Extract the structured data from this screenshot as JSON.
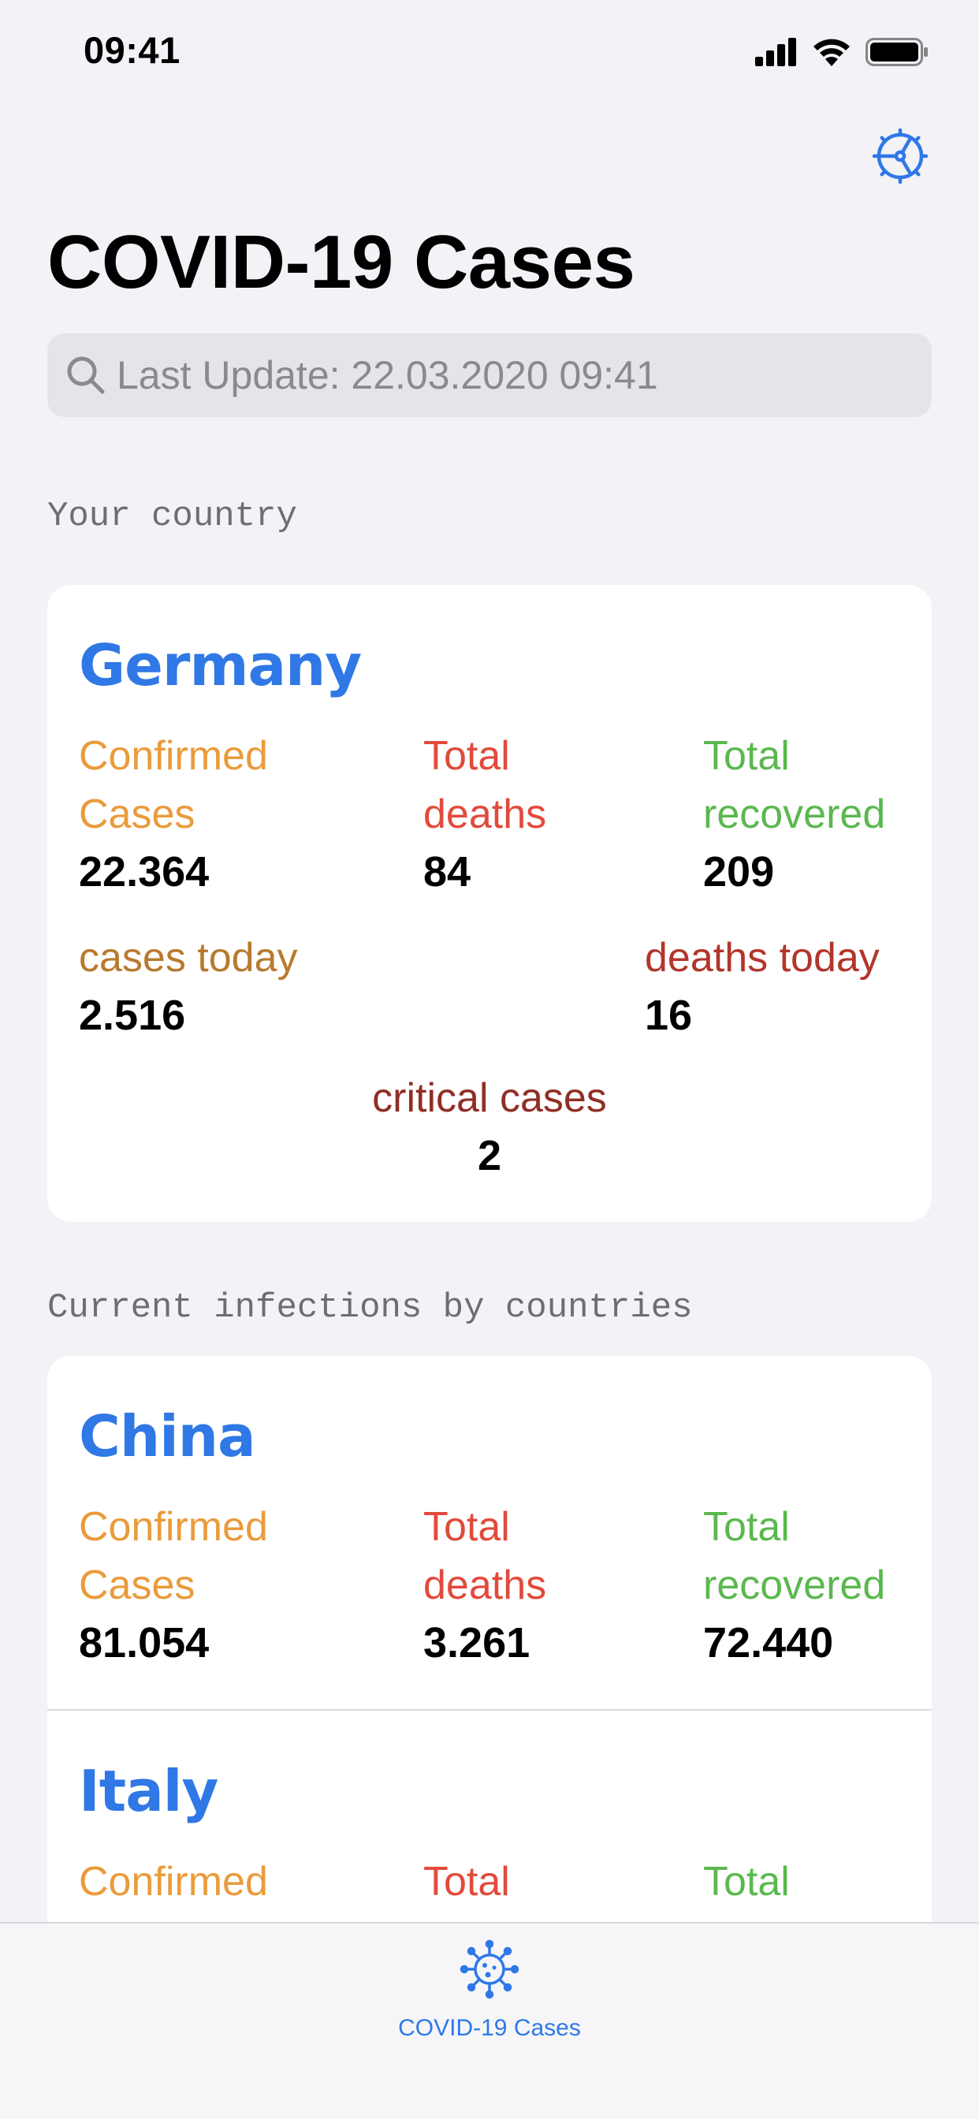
{
  "status_bar": {
    "time": "09:41"
  },
  "header": {
    "title": "COVID-19 Cases",
    "settings_icon": "gear-icon"
  },
  "search": {
    "placeholder": "Last Update: 22.03.2020 09:41"
  },
  "sections": {
    "your_country": "Your country",
    "by_countries": "Current infections by countries"
  },
  "labels": {
    "confirmed": "Confirmed Cases",
    "deaths": "Total deaths",
    "recovered": "Total recovered",
    "cases_today": "cases today",
    "deaths_today": "deaths today",
    "critical": "critical cases"
  },
  "my_country": {
    "name": "Germany",
    "confirmed": "22.364",
    "deaths": "84",
    "recovered": "209",
    "cases_today": "2.516",
    "deaths_today": "16",
    "critical": "2"
  },
  "countries": [
    {
      "name": "China",
      "confirmed": "81.054",
      "deaths": "3.261",
      "recovered": "72.440"
    },
    {
      "name": "Italy"
    }
  ],
  "tab_bar": {
    "items": [
      {
        "label": "COVID-19 Cases",
        "icon": "virus-icon"
      }
    ]
  },
  "colors": {
    "accent": "#2f78e6",
    "confirmed": "#ea9b3b",
    "deaths": "#e24a3b",
    "recovered": "#5bb84f",
    "cases_today": "#b87a2e",
    "deaths_today": "#b2352a",
    "critical": "#8f2f25"
  }
}
